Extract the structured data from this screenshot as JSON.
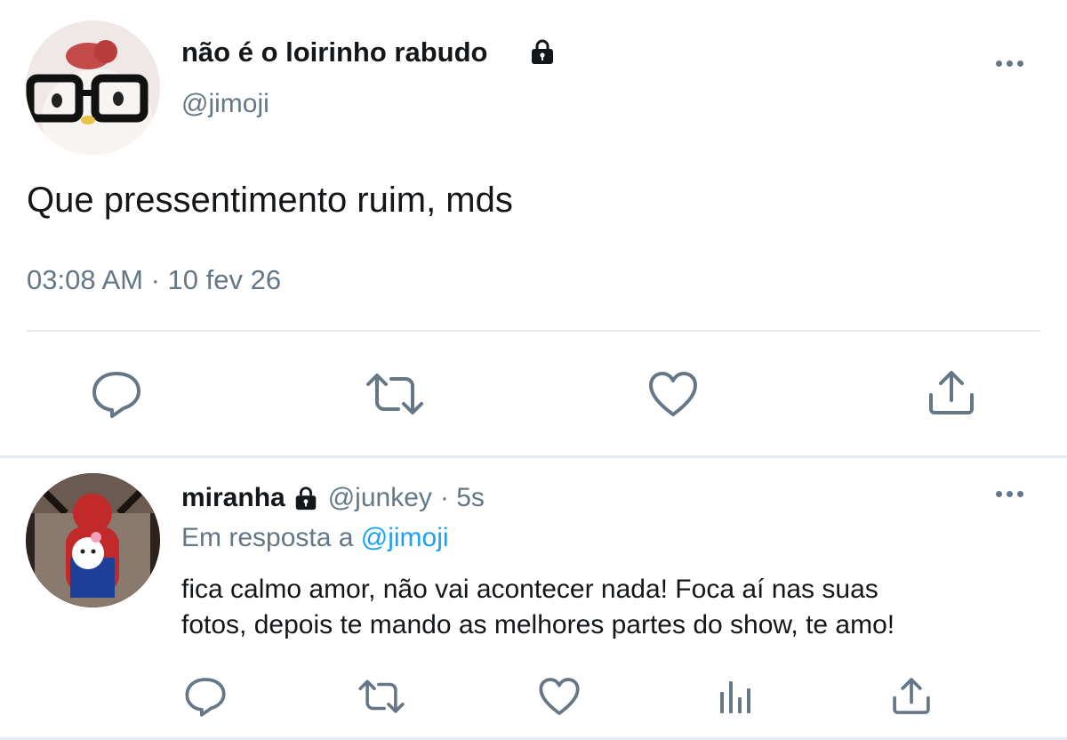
{
  "main_tweet": {
    "display_name": "não é o loirinho rabudo",
    "handle": "@jimoji",
    "text": "Que pressentimento ruim, mds",
    "timestamp": "03:08 AM · 10 fev 26",
    "protected_icon": "lock-icon",
    "actions": [
      "reply-icon",
      "retweet-icon",
      "like-icon",
      "share-icon"
    ]
  },
  "reply": {
    "display_name": "miranha",
    "handle": "@junkey",
    "time": "· 5s",
    "reply_prefix": "Em resposta a",
    "reply_to": "@jimoji",
    "text_line1": "fica calmo amor, não vai acontecer nada! Foca aí nas suas",
    "text_line2": "fotos, depois te mando as melhores partes do show, te amo!",
    "protected_icon": "lock-icon",
    "actions": [
      "reply-icon",
      "retweet-icon",
      "like-icon",
      "analytics-icon",
      "share-icon"
    ]
  },
  "colors": {
    "muted": "#657786",
    "link": "#1da1f2",
    "divider": "#e6ecf0"
  }
}
